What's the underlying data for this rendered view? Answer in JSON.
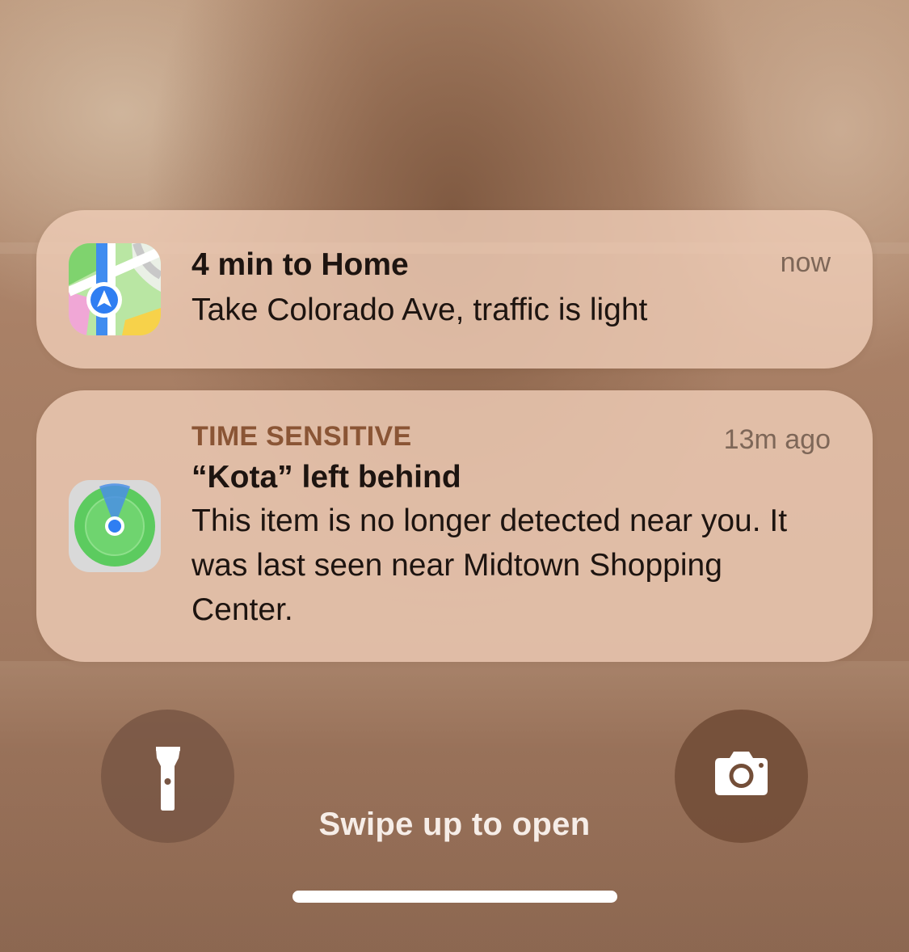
{
  "notifications": [
    {
      "app": "Maps",
      "icon": "maps-app-icon",
      "title": "4 min to Home",
      "body": "Take Colorado Ave, traffic is light",
      "time": "now"
    },
    {
      "app": "Find My",
      "icon": "find-my-app-icon",
      "label": "TIME SENSITIVE",
      "title": "“Kota” left behind",
      "body": "This item is no longer detected near you. It was last seen near Midtown Shopping Center.",
      "time": "13m ago"
    }
  ],
  "lockscreen": {
    "flashlight_icon": "flashlight-icon",
    "camera_icon": "camera-icon",
    "swipe_text": "Swipe up to open"
  },
  "colors": {
    "notification_bg": "#eeccb6",
    "time_sensitive_label": "#8a5535",
    "button_bg": "#76563f",
    "home_indicator": "#ffffff"
  }
}
